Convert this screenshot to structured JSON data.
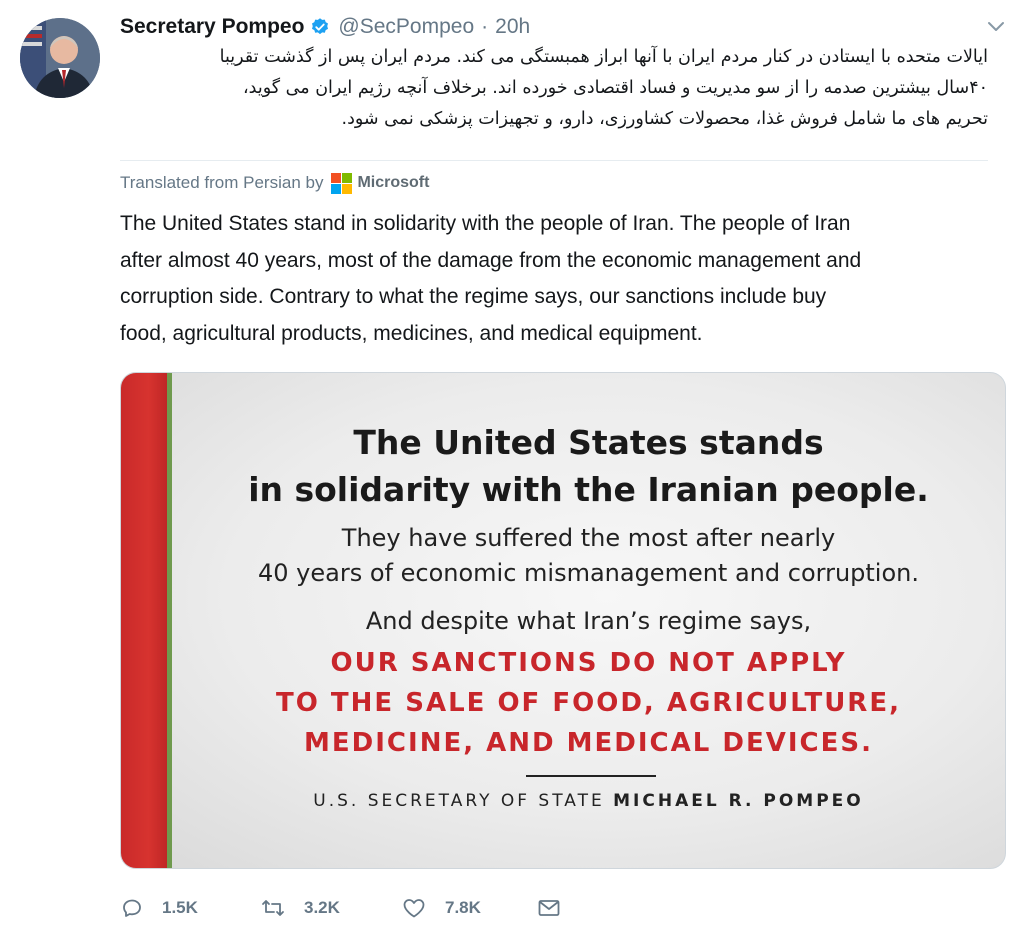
{
  "tweet": {
    "author_name": "Secretary Pompeo",
    "handle": "@SecPompeo",
    "separator": "·",
    "time": "20h",
    "persian_lines": [
      "ایالات متحده با ایستادن در کنار مردم ایران با آنها ابراز همبستگی می کند.  مردم ایران پس از گذشت تقریبا",
      "۴۰سال بیشترین صدمه را از سو مدیریت و فساد اقتصادی خورده اند.  برخلاف آنچه رژیم ایران می گوید،",
      "تحریم های ما شامل فروش غذا، محصولات کشاورزی، دارو، و تجهیزات پزشکی نمی شود."
    ],
    "translated_label": "Translated from Persian by",
    "translator_name": "Microsoft",
    "english_lines": [
      "The United States stand in solidarity with the people of Iran.  The people of Iran",
      "after almost 40 years, most of the damage from the economic management and",
      "corruption side.  Contrary to what the regime says, our sanctions include buy",
      "food, agricultural products, medicines, and medical equipment."
    ]
  },
  "card": {
    "headline_1": "The United States stands",
    "headline_2": "in solidarity with the Iranian people.",
    "body_1": "They have suffered the most after nearly",
    "body_2": "40 years of economic mismanagement and corruption.",
    "body_3": "And despite what Iran’s regime says,",
    "red_1": "OUR SANCTIONS DO NOT APPLY",
    "red_2": "TO THE SALE OF FOOD, AGRICULTURE,",
    "red_3": "MEDICINE, AND MEDICAL DEVICES.",
    "sig_prefix": "U.S. SECRETARY OF STATE ",
    "sig_name": "MICHAEL R. POMPEO"
  },
  "actions": {
    "reply_count": "1.5K",
    "retweet_count": "3.2K",
    "like_count": "7.8K"
  },
  "colors": {
    "verified": "#1da1f2",
    "muted": "#657786",
    "card_red_text": "#c8262b",
    "card_red_bar": "#d7332f",
    "card_green_bar": "#6f9a4e"
  },
  "icons": [
    "verified-badge-icon",
    "chevron-down-icon",
    "microsoft-logo-icon",
    "reply-icon",
    "retweet-icon",
    "like-icon",
    "direct-message-icon"
  ]
}
